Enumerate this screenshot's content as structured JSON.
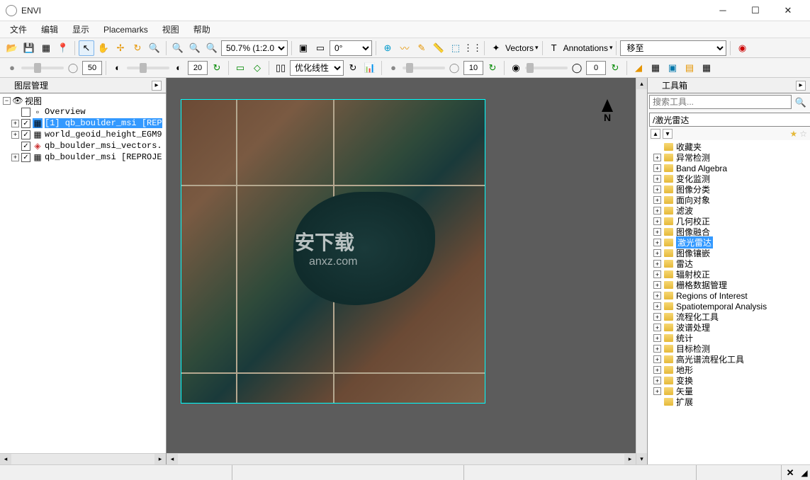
{
  "app": {
    "title": "ENVI"
  },
  "menus": [
    "文件",
    "编辑",
    "显示",
    "Placemarks",
    "视图",
    "帮助"
  ],
  "toolbar1": {
    "zoom_value": "50.7% (1:2.0..",
    "rotation": "0°",
    "vectors_label": "Vectors",
    "annotations_label": "Annotations",
    "goto_label": "移至"
  },
  "toolbar2": {
    "val1": "50",
    "val2": "20",
    "stretch_mode": "优化线性",
    "val3": "10",
    "val4": "0"
  },
  "left_panel": {
    "title": "图层管理",
    "root": "视图",
    "layers": [
      {
        "name": "Overview",
        "checked": false
      },
      {
        "name": "[1] qb_boulder_msi [REP",
        "checked": true,
        "selected": true
      },
      {
        "name": "world_geoid_height_EGM9",
        "checked": true
      },
      {
        "name": "qb_boulder_msi_vectors.",
        "checked": true
      },
      {
        "name": "qb_boulder_msi [REPROJE",
        "checked": true
      }
    ]
  },
  "right_panel": {
    "title": "工具箱",
    "search_placeholder": "搜索工具...",
    "path": "/激光雷达",
    "items": [
      {
        "label": "收藏夹",
        "exp": false
      },
      {
        "label": "异常检测",
        "exp": true
      },
      {
        "label": "Band Algebra",
        "exp": true
      },
      {
        "label": "变化监测",
        "exp": true
      },
      {
        "label": "图像分类",
        "exp": true
      },
      {
        "label": "面向对象",
        "exp": true
      },
      {
        "label": "滤波",
        "exp": true
      },
      {
        "label": "几何校正",
        "exp": true
      },
      {
        "label": "图像融合",
        "exp": true
      },
      {
        "label": "激光雷达",
        "exp": true,
        "selected": true
      },
      {
        "label": "图像镶嵌",
        "exp": true
      },
      {
        "label": "雷达",
        "exp": true
      },
      {
        "label": "辐射校正",
        "exp": true
      },
      {
        "label": "栅格数据管理",
        "exp": true
      },
      {
        "label": "Regions of Interest",
        "exp": true
      },
      {
        "label": "Spatiotemporal Analysis",
        "exp": true
      },
      {
        "label": "流程化工具",
        "exp": true
      },
      {
        "label": "波谱处理",
        "exp": true
      },
      {
        "label": "统计",
        "exp": true
      },
      {
        "label": "目标检测",
        "exp": true
      },
      {
        "label": "高光谱流程化工具",
        "exp": true
      },
      {
        "label": "地形",
        "exp": true
      },
      {
        "label": "变换",
        "exp": true
      },
      {
        "label": "矢量",
        "exp": true
      },
      {
        "label": "扩展",
        "exp": false
      }
    ]
  },
  "north_label": "N",
  "watermark": "安下载",
  "watermark_sub": "anxz.com"
}
